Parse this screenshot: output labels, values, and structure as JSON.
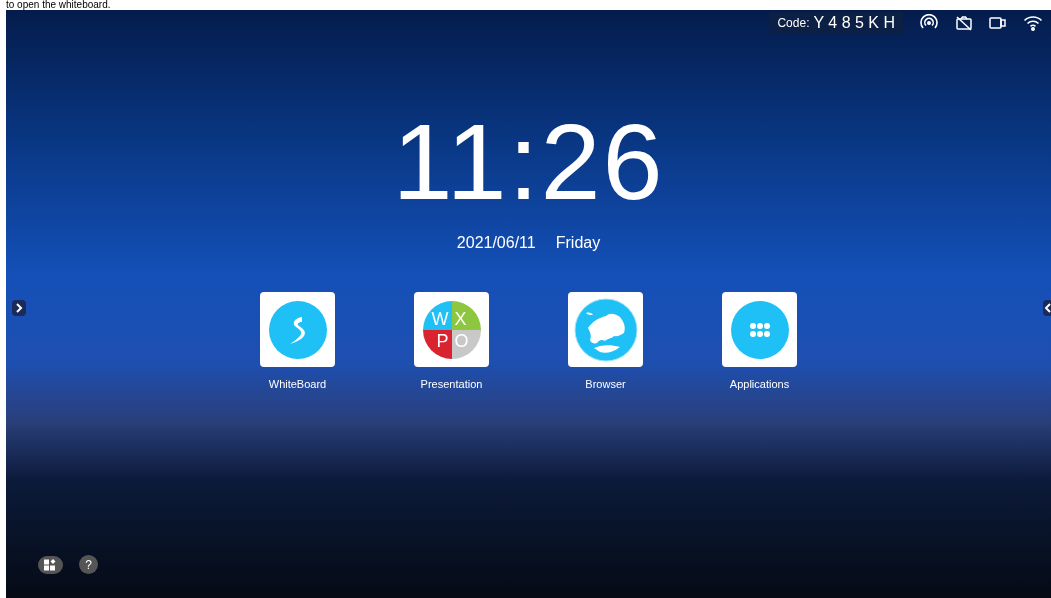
{
  "caption": "to open the whiteboard.",
  "status_bar": {
    "code_label": "Code:",
    "code": "Y 4 8 5 K H"
  },
  "clock": {
    "time": "11:26",
    "date": "2021/06/11",
    "weekday": "Friday"
  },
  "apps": [
    {
      "kind": "whiteboard",
      "label": "WhiteBoard"
    },
    {
      "kind": "presentation",
      "label": "Presentation",
      "letters": [
        "W",
        "X",
        "P",
        "O"
      ]
    },
    {
      "kind": "browser",
      "label": "Browser"
    },
    {
      "kind": "applications",
      "label": "Applications"
    }
  ],
  "help_button": "?"
}
